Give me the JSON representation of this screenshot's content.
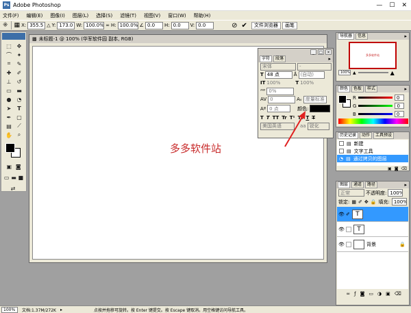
{
  "app": {
    "title": "Adobe Photoshop"
  },
  "menu": [
    "文件(F)",
    "编辑(E)",
    "图像(I)",
    "图层(L)",
    "选择(S)",
    "滤镜(T)",
    "视图(V)",
    "窗口(W)",
    "帮助(H)"
  ],
  "options": {
    "x_label": "X:",
    "x_value": "355.5",
    "y_label": "Y:",
    "y_value": "173.0",
    "w_label": "W:",
    "w_value": "100.0%",
    "h_label": "H:",
    "h_value": "100.0%",
    "angle_value": "0.0",
    "hskew_label": "H:",
    "hskew_value": "0.0",
    "vskew_label": "V:",
    "vskew_value": "0.0",
    "tabs": [
      "文件浏览器",
      "画笔"
    ]
  },
  "document": {
    "title": "未标题-1 @ 100% (华军软件园 副本, RGB)",
    "text": "多多软件站"
  },
  "char_panel": {
    "tabs": [
      "字符",
      "段落"
    ],
    "font": "宋体",
    "style": "-",
    "size": "48 点",
    "leading": "(自动)",
    "vscale": "100%",
    "hscale": "100%",
    "tracking_pct": "0%",
    "kerning": "0",
    "kern_mode": "度量标准",
    "baseline": "0 点",
    "color_label": "颜色:",
    "text_styles": [
      "T",
      "T",
      "TT",
      "Tr",
      "T¹",
      "T₁",
      "T",
      "T"
    ],
    "language": "美国英语",
    "aa_icon": "aa",
    "aa_mode": "锐化"
  },
  "navigator": {
    "tabs": [
      "导航器",
      "信息"
    ],
    "zoom": "100%",
    "thumb_text": "多多软件站"
  },
  "color_panel": {
    "tabs": [
      "颜色",
      "色板",
      "样式"
    ],
    "r": "0",
    "g": "0",
    "b": "0",
    "r_label": "R",
    "g_label": "G",
    "b_label": "B"
  },
  "history": {
    "tabs": [
      "历史记录",
      "动作",
      "工具预设"
    ],
    "items": [
      "新建",
      "文字工具",
      "通过拷贝的图层"
    ]
  },
  "layers": {
    "tabs": [
      "图层",
      "通道",
      "路径"
    ],
    "mode": "正常",
    "opacity_label": "不透明度:",
    "opacity": "100%",
    "lock_label": "锁定:",
    "fill_label": "填充:",
    "fill": "100%",
    "items": [
      {
        "name": "",
        "thumb": "T",
        "selected": true
      },
      {
        "name": "",
        "thumb": "T",
        "selected": false
      },
      {
        "name": "背景",
        "thumb": "",
        "selected": false
      }
    ]
  },
  "status": {
    "zoom": "100%",
    "doc": "文档:1.37M/272K",
    "hint": "点按并拖移可旋转。按 Enter 键提交。按 Escape 键取消。用空格键访问导航工具。"
  },
  "colors": {
    "accent": "#3399ff",
    "arrow": "#e02020",
    "doc_text": "#c82a2a"
  }
}
